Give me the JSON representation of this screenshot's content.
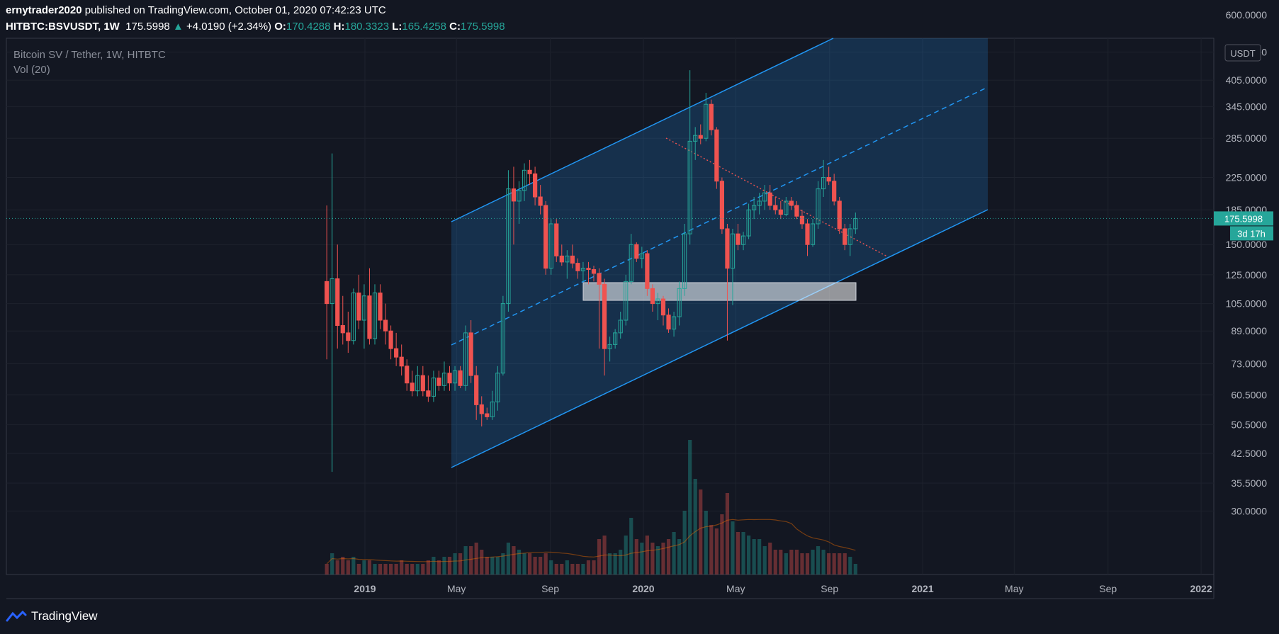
{
  "header": {
    "author": "ernytrader2020",
    "published_text": " published on TradingView.com, October 01, 2020 07:42:23 UTC",
    "symbol": "HITBTC:BSVUSDT, 1W",
    "last": "175.5998",
    "change": "+4.0190 (+2.34%)",
    "open_label": "O:",
    "open": "170.4288",
    "high_label": "H:",
    "high": "180.3323",
    "low_label": "L:",
    "low": "165.4258",
    "close_label": "C:",
    "close": "175.5998"
  },
  "legend": {
    "title": "Bitcoin SV / Tether, 1W, HITBTC",
    "volume": "Vol (20)"
  },
  "price_axis": {
    "currency": "USDT",
    "last_price_label": "175.5998",
    "countdown_label": "3d 17h"
  },
  "branding": {
    "name": "TradingView"
  },
  "colors": {
    "background": "#131722",
    "up": "#26a69a",
    "down": "#ef5350",
    "channel": "#2196f3",
    "grid": "#1e222d"
  },
  "chart_data": {
    "type": "candlestick",
    "y_scale": "log",
    "y_ticks": [
      "600.0000",
      "480.0000",
      "405.0000",
      "345.0000",
      "285.0000",
      "225.0000",
      "185.0000",
      "150.0000",
      "125.0000",
      "105.0000",
      "89.0000",
      "73.0000",
      "60.5000",
      "50.5000",
      "42.5000",
      "35.5000",
      "30.0000"
    ],
    "y_tick_values": [
      600,
      480,
      405,
      345,
      285,
      225,
      185,
      150,
      125,
      105,
      89,
      73,
      60.5,
      50.5,
      42.5,
      35.5,
      30
    ],
    "x_ticks": [
      "2019",
      "May",
      "Sep",
      "2020",
      "May",
      "Sep",
      "2021",
      "May",
      "Sep",
      "2022"
    ],
    "x_tick_dates": [
      "2019-01-01",
      "2019-05-01",
      "2019-09-01",
      "2020-01-01",
      "2020-05-01",
      "2020-09-01",
      "2021-01-01",
      "2021-05-01",
      "2021-09-01",
      "2022-01-01"
    ],
    "bold_ticks": [
      "2019",
      "2020",
      "2021",
      "2022"
    ],
    "last_price": 175.5998,
    "series": [
      {
        "type": "candles",
        "columns": [
          "date",
          "open",
          "high",
          "low",
          "close",
          "volume"
        ],
        "data": [
          [
            "2018-11-12",
            120,
            190,
            75,
            105,
            3
          ],
          [
            "2018-11-19",
            105,
            260,
            38,
            122,
            6
          ],
          [
            "2018-11-26",
            122,
            150,
            80,
            92,
            4
          ],
          [
            "2018-12-03",
            92,
            110,
            82,
            88,
            5
          ],
          [
            "2018-12-10",
            88,
            100,
            78,
            84,
            4
          ],
          [
            "2018-12-17",
            84,
            115,
            82,
            112,
            5
          ],
          [
            "2018-12-24",
            112,
            125,
            90,
            95,
            3
          ],
          [
            "2018-12-31",
            95,
            118,
            80,
            110,
            4
          ],
          [
            "2019-01-07",
            110,
            130,
            82,
            85,
            4
          ],
          [
            "2019-01-14",
            85,
            118,
            82,
            112,
            3
          ],
          [
            "2019-01-21",
            112,
            118,
            90,
            95,
            3
          ],
          [
            "2019-01-28",
            95,
            105,
            82,
            89,
            3
          ],
          [
            "2019-02-04",
            89,
            92,
            75,
            80,
            3
          ],
          [
            "2019-02-11",
            80,
            88,
            72,
            76,
            3
          ],
          [
            "2019-02-18",
            76,
            82,
            68,
            72,
            4
          ],
          [
            "2019-02-25",
            72,
            75,
            62,
            65,
            3
          ],
          [
            "2019-03-04",
            65,
            70,
            60,
            62,
            3
          ],
          [
            "2019-03-11",
            62,
            72,
            60,
            68,
            3
          ],
          [
            "2019-03-18",
            68,
            72,
            60,
            62,
            3
          ],
          [
            "2019-03-25",
            62,
            68,
            58,
            60,
            4
          ],
          [
            "2019-04-01",
            60,
            70,
            58,
            67,
            5
          ],
          [
            "2019-04-08",
            67,
            70,
            62,
            64,
            4
          ],
          [
            "2019-04-15",
            64,
            74,
            62,
            69,
            5
          ],
          [
            "2019-04-22",
            69,
            72,
            62,
            65,
            5
          ],
          [
            "2019-04-29",
            65,
            72,
            62,
            70,
            6
          ],
          [
            "2019-05-06",
            70,
            72,
            63,
            64,
            6
          ],
          [
            "2019-05-13",
            64,
            92,
            62,
            88,
            8
          ],
          [
            "2019-05-20",
            88,
            95,
            65,
            68,
            8
          ],
          [
            "2019-05-27",
            68,
            72,
            52,
            57,
            9
          ],
          [
            "2019-06-03",
            57,
            60,
            50,
            54,
            7
          ],
          [
            "2019-06-10",
            54,
            56,
            52,
            53,
            5
          ],
          [
            "2019-06-17",
            53,
            62,
            52,
            58,
            5
          ],
          [
            "2019-06-24",
            58,
            72,
            55,
            69,
            5
          ],
          [
            "2019-07-01",
            69,
            110,
            68,
            105,
            6
          ],
          [
            "2019-07-08",
            105,
            235,
            100,
            210,
            9
          ],
          [
            "2019-07-15",
            210,
            240,
            150,
            195,
            8
          ],
          [
            "2019-07-22",
            195,
            220,
            170,
            208,
            7
          ],
          [
            "2019-07-29",
            208,
            245,
            195,
            235,
            6
          ],
          [
            "2019-08-05",
            235,
            250,
            215,
            230,
            6
          ],
          [
            "2019-08-12",
            230,
            240,
            190,
            200,
            5
          ],
          [
            "2019-08-19",
            200,
            215,
            180,
            190,
            5
          ],
          [
            "2019-08-26",
            190,
            195,
            125,
            130,
            6
          ],
          [
            "2019-09-02",
            130,
            175,
            125,
            170,
            4
          ],
          [
            "2019-09-09",
            170,
            175,
            135,
            140,
            3
          ],
          [
            "2019-09-16",
            140,
            150,
            132,
            135,
            3
          ],
          [
            "2019-09-23",
            135,
            145,
            122,
            140,
            4
          ],
          [
            "2019-09-30",
            140,
            150,
            130,
            134,
            3
          ],
          [
            "2019-10-07",
            134,
            138,
            122,
            128,
            3
          ],
          [
            "2019-10-14",
            128,
            135,
            120,
            130,
            3
          ],
          [
            "2019-10-21",
            130,
            135,
            118,
            129,
            4
          ],
          [
            "2019-10-28",
            129,
            132,
            120,
            126,
            4
          ],
          [
            "2019-11-04",
            126,
            130,
            80,
            118,
            10
          ],
          [
            "2019-11-11",
            118,
            122,
            68,
            80,
            11
          ],
          [
            "2019-11-18",
            80,
            86,
            74,
            82,
            6
          ],
          [
            "2019-11-25",
            82,
            90,
            80,
            88,
            6
          ],
          [
            "2019-12-02",
            88,
            100,
            85,
            95,
            7
          ],
          [
            "2019-12-09",
            95,
            125,
            92,
            120,
            11
          ],
          [
            "2019-12-16",
            120,
            160,
            118,
            150,
            16
          ],
          [
            "2019-12-23",
            150,
            152,
            135,
            138,
            10
          ],
          [
            "2019-12-30",
            138,
            148,
            130,
            142,
            9
          ],
          [
            "2020-01-06",
            142,
            145,
            110,
            115,
            11
          ],
          [
            "2020-01-13",
            115,
            118,
            100,
            105,
            9
          ],
          [
            "2020-01-20",
            105,
            112,
            95,
            108,
            8
          ],
          [
            "2020-01-27",
            108,
            110,
            92,
            98,
            9
          ],
          [
            "2020-02-03",
            98,
            102,
            88,
            90,
            10
          ],
          [
            "2020-02-10",
            90,
            100,
            86,
            97,
            12
          ],
          [
            "2020-02-17",
            97,
            120,
            92,
            115,
            10
          ],
          [
            "2020-02-24",
            115,
            170,
            110,
            160,
            18
          ],
          [
            "2020-03-02",
            160,
            430,
            150,
            280,
            38
          ],
          [
            "2020-03-09",
            280,
            305,
            250,
            290,
            27
          ],
          [
            "2020-03-16",
            290,
            310,
            275,
            285,
            24
          ],
          [
            "2020-03-23",
            285,
            375,
            280,
            350,
            18
          ],
          [
            "2020-03-30",
            350,
            360,
            290,
            300,
            14
          ],
          [
            "2020-04-06",
            300,
            305,
            210,
            220,
            13
          ],
          [
            "2020-04-13",
            220,
            225,
            160,
            165,
            17
          ],
          [
            "2020-04-20",
            165,
            170,
            84,
            130,
            23
          ],
          [
            "2020-04-27",
            130,
            165,
            104,
            160,
            15
          ],
          [
            "2020-05-04",
            160,
            170,
            145,
            150,
            12
          ],
          [
            "2020-05-11",
            150,
            162,
            145,
            158,
            12
          ],
          [
            "2020-05-18",
            158,
            192,
            155,
            185,
            11
          ],
          [
            "2020-05-25",
            185,
            200,
            175,
            190,
            10
          ],
          [
            "2020-06-01",
            190,
            205,
            180,
            195,
            10
          ],
          [
            "2020-06-08",
            195,
            215,
            185,
            205,
            8
          ],
          [
            "2020-06-15",
            205,
            215,
            185,
            190,
            9
          ],
          [
            "2020-06-22",
            190,
            200,
            180,
            185,
            7
          ],
          [
            "2020-06-29",
            185,
            195,
            175,
            180,
            7
          ],
          [
            "2020-07-06",
            180,
            200,
            178,
            195,
            6
          ],
          [
            "2020-07-13",
            195,
            200,
            185,
            190,
            7
          ],
          [
            "2020-07-20",
            190,
            195,
            175,
            178,
            7
          ],
          [
            "2020-07-27",
            178,
            185,
            165,
            170,
            6
          ],
          [
            "2020-08-03",
            170,
            175,
            140,
            150,
            6
          ],
          [
            "2020-08-10",
            150,
            175,
            148,
            170,
            7
          ],
          [
            "2020-08-17",
            170,
            220,
            165,
            210,
            8
          ],
          [
            "2020-08-24",
            210,
            250,
            200,
            225,
            7
          ],
          [
            "2020-08-31",
            225,
            240,
            215,
            220,
            6
          ],
          [
            "2020-09-07",
            220,
            230,
            190,
            195,
            6
          ],
          [
            "2020-09-14",
            195,
            200,
            160,
            165,
            6
          ],
          [
            "2020-09-21",
            165,
            170,
            145,
            150,
            6
          ],
          [
            "2020-09-28",
            150,
            170,
            140,
            165,
            5
          ],
          [
            "2020-10-05",
            165,
            182,
            160,
            175.5998,
            3
          ]
        ]
      },
      {
        "type": "volume_ma",
        "period": 20
      }
    ]
  }
}
